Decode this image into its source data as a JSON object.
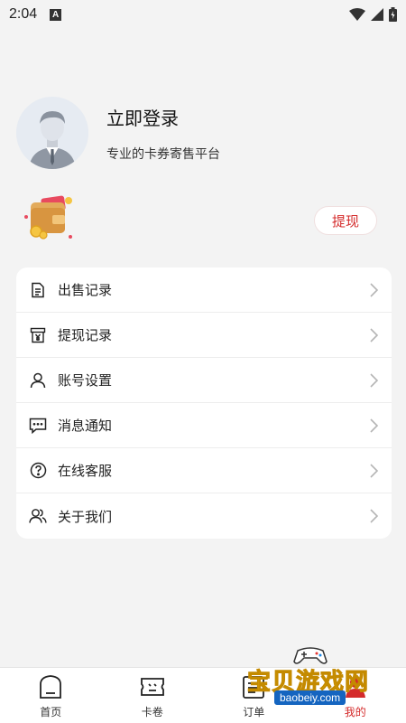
{
  "status_bar": {
    "time": "2:04",
    "notification_letter": "A"
  },
  "profile": {
    "login_title": "立即登录",
    "slogan": "专业的卡券寄售平台"
  },
  "wallet": {
    "withdraw_label": "提现"
  },
  "menu": {
    "items": [
      {
        "label": "出售记录",
        "icon": "document-icon"
      },
      {
        "label": "提现记录",
        "icon": "yen-receipt-icon"
      },
      {
        "label": "账号设置",
        "icon": "user-icon"
      },
      {
        "label": "消息通知",
        "icon": "chat-icon"
      },
      {
        "label": "在线客服",
        "icon": "help-icon"
      },
      {
        "label": "关于我们",
        "icon": "users-icon"
      }
    ]
  },
  "tabbar": {
    "tabs": [
      {
        "label": "首页",
        "icon": "home-icon"
      },
      {
        "label": "卡卷",
        "icon": "ticket-icon"
      },
      {
        "label": "订单",
        "icon": "order-icon"
      },
      {
        "label": "我的",
        "icon": "profile-icon"
      }
    ],
    "active_index": 3
  },
  "watermark": {
    "text_cn": "宝贝游戏网",
    "text_en": "baobeiy.com"
  },
  "colors": {
    "accent": "#d42b2b",
    "background": "#f3f3f3",
    "card": "#ffffff"
  }
}
